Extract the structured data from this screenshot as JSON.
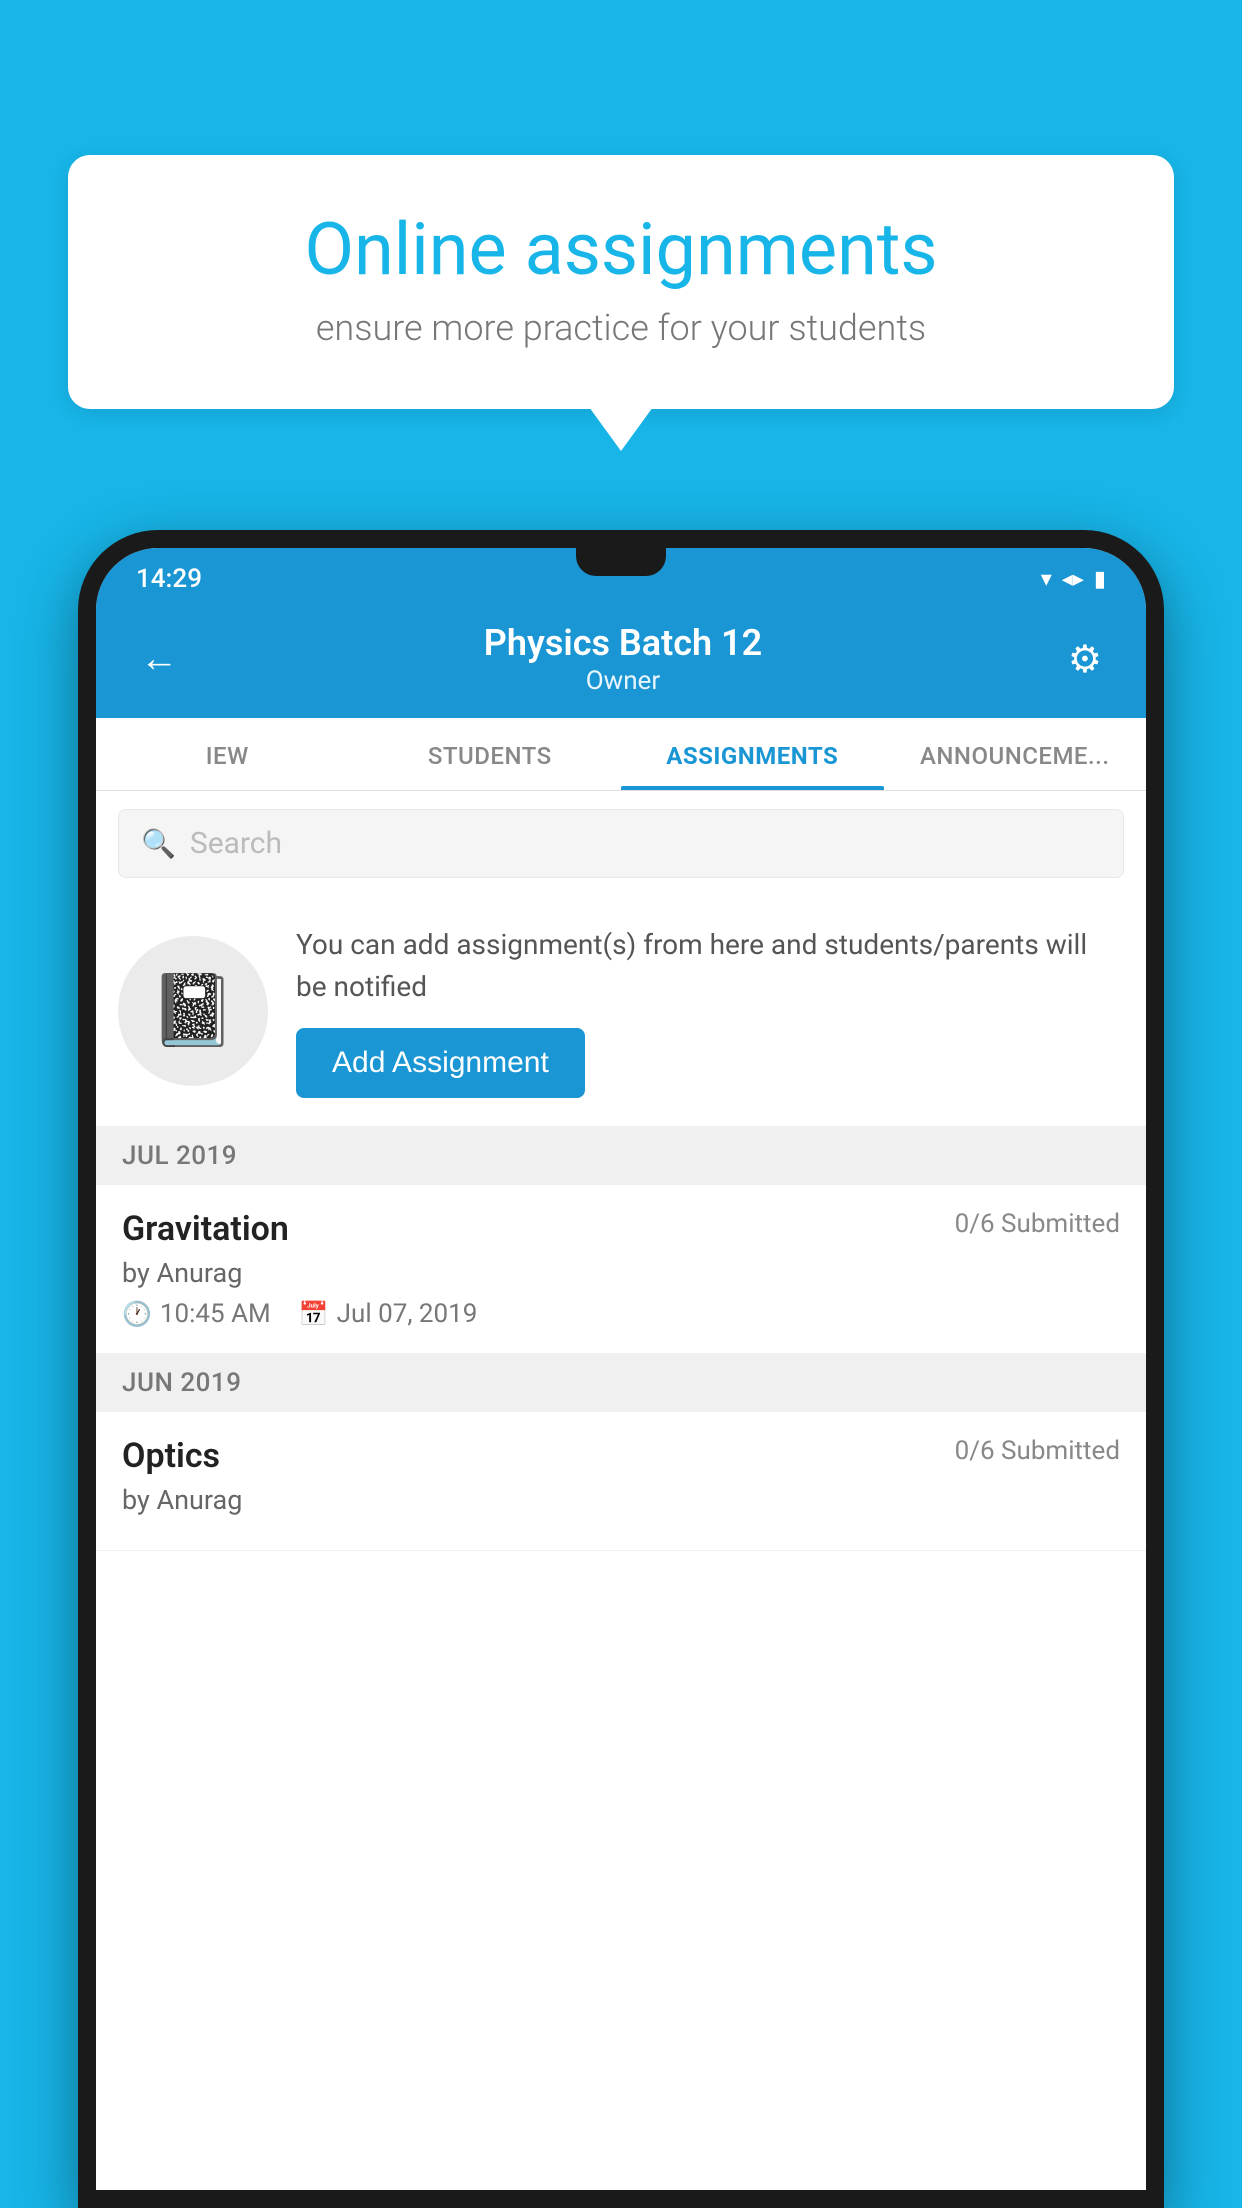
{
  "background_color": "#17b5e8",
  "speech_bubble": {
    "title": "Online assignments",
    "subtitle": "ensure more practice for your students"
  },
  "status_bar": {
    "time": "14:29",
    "wifi_icon": "▾",
    "signal_icon": "▲",
    "battery_icon": "▮"
  },
  "app_header": {
    "back_icon": "←",
    "title": "Physics Batch 12",
    "subtitle": "Owner",
    "settings_icon": "⚙"
  },
  "tabs": [
    {
      "label": "IEW",
      "active": false
    },
    {
      "label": "STUDENTS",
      "active": false
    },
    {
      "label": "ASSIGNMENTS",
      "active": true
    },
    {
      "label": "ANNOUNCEMENTS",
      "active": false
    }
  ],
  "search": {
    "placeholder": "Search"
  },
  "promo": {
    "text": "You can add assignment(s) from here and students/parents will be notified",
    "button_label": "Add Assignment"
  },
  "sections": [
    {
      "header": "JUL 2019",
      "assignments": [
        {
          "title": "Gravitation",
          "submitted": "0/6 Submitted",
          "by": "by Anurag",
          "time": "10:45 AM",
          "date": "Jul 07, 2019"
        }
      ]
    },
    {
      "header": "JUN 2019",
      "assignments": [
        {
          "title": "Optics",
          "submitted": "0/6 Submitted",
          "by": "by Anurag",
          "time": "",
          "date": ""
        }
      ]
    }
  ]
}
